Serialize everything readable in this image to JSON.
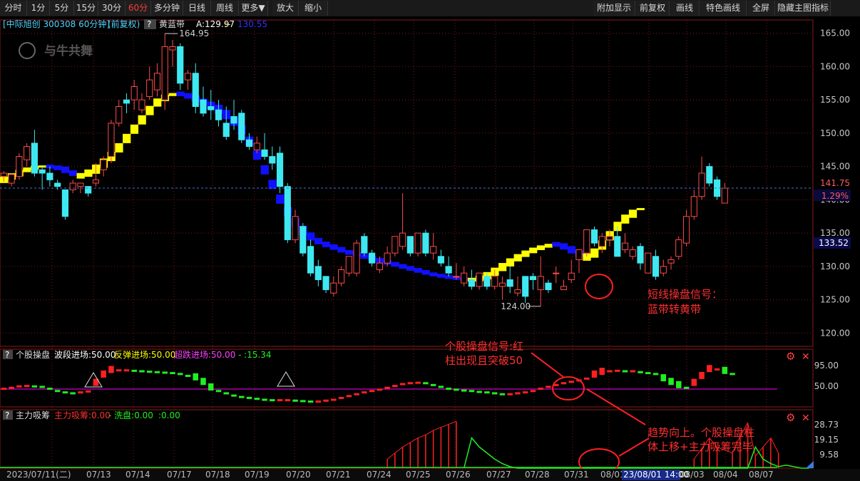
{
  "toolbar": {
    "left": [
      "分时",
      "1分",
      "5分",
      "15分",
      "30分",
      "60分",
      "多分钟",
      "日线",
      "周线",
      "更多▼",
      "放大",
      "缩小"
    ],
    "active": "60分",
    "right": [
      "附加显示",
      "前复权",
      "画线",
      "特色画线",
      "全屏",
      "隐藏主图指标"
    ]
  },
  "header": {
    "title": "[中际旭创 300308 60分钟]",
    "adj": "(前复权)",
    "help": "?",
    "indicator": "黄蓝带",
    "a_value": "A:129.97",
    "sep": ":-",
    "b_value": "130.55",
    "logo": "与牛共舞"
  },
  "colors": {
    "up": "#ff4a4a",
    "down": "#3ee8f0",
    "yellow": "#ffff00",
    "blue": "#1010ff",
    "green": "#20ee20",
    "magenta": "#ff00ff",
    "grid": "#7a1a1a",
    "axis_text": "#c8c8c8"
  },
  "annotations": {
    "high_label": "164.95",
    "low_label": "124.00",
    "current_price": "141.75",
    "change_pct": "1.29%",
    "band_price": "133.52",
    "note1": [
      "短线操盘信号：",
      "蓝带转黄带"
    ],
    "note2": [
      "个股操盘信号:红",
      "柱出现且突破50"
    ],
    "note3": [
      "趋势向上。个股操盘柱",
      "体上移+主力吸筹完毕"
    ]
  },
  "sub1": {
    "help": "?",
    "name": "个股操盘",
    "l1": "波段进场:50.00",
    "l2": "反弹进场:50.00",
    "l3": "超跌进场:50.00",
    "l4": "- :15.34",
    "yticks": [
      "95.00",
      "50.00"
    ]
  },
  "sub2": {
    "help": "?",
    "name": "主力吸筹",
    "l1": "主力吸筹:0.00",
    "l2": "- 洗盘:0.00",
    "l3": ":0.00",
    "yticks": [
      "28.73",
      "19.15",
      "9.58"
    ]
  },
  "xaxis": {
    "labels": [
      "2023/07/11(二)",
      "07/13",
      "07/14",
      "07/17",
      "07/18",
      "07/19",
      "07/20",
      "07/21",
      "07/24",
      "07/25",
      "07/26",
      "07/27",
      "07/28",
      "07/31",
      "08/01",
      "08/03",
      "08/04",
      "08/07"
    ],
    "cursor_label": "23/08/01 14:00"
  },
  "chart_data": {
    "type": "candlestick",
    "title": "[中际旭创 300308 60分钟]",
    "ylim": [
      118,
      167
    ],
    "yticks": [
      120,
      125,
      130,
      135,
      140,
      145,
      150,
      155,
      160,
      165
    ],
    "grid": true,
    "candles": [
      [
        143.5,
        144.3,
        144.0,
        142.7
      ],
      [
        142.5,
        144.0,
        143.8,
        142.0
      ],
      [
        143.5,
        147.0,
        146.5,
        143.0
      ],
      [
        146.0,
        148.5,
        148.0,
        145.0
      ],
      [
        148.5,
        150.5,
        144.0,
        143.5
      ],
      [
        144.5,
        145.0,
        144.0,
        141.5
      ],
      [
        144.0,
        145.0,
        143.0,
        142.0
      ],
      [
        142.5,
        143.0,
        142.0,
        141.5
      ],
      [
        141.5,
        141.5,
        137.5,
        137.0
      ],
      [
        141.5,
        143.0,
        142.5,
        141.0
      ],
      [
        142.0,
        142.5,
        142.5,
        141.0
      ],
      [
        142.0,
        142.0,
        141.0,
        140.5
      ],
      [
        142.5,
        145.5,
        143.0,
        142.0
      ],
      [
        144.5,
        146.5,
        146.0,
        143.5
      ],
      [
        146.5,
        152.0,
        151.5,
        145.5
      ],
      [
        151.5,
        155.0,
        154.0,
        151.0
      ],
      [
        155.0,
        156.0,
        154.5,
        153.0
      ],
      [
        155.0,
        158.0,
        157.0,
        153.5
      ],
      [
        153.5,
        156.0,
        155.0,
        153.0
      ],
      [
        155.5,
        160.0,
        158.0,
        155.0
      ],
      [
        156.5,
        160.5,
        159.0,
        155.5
      ],
      [
        155.0,
        164.95,
        163.0,
        153.5
      ],
      [
        162.5,
        164.0,
        163.0,
        160.0
      ],
      [
        163.0,
        163.5,
        157.5,
        156.5
      ],
      [
        158.0,
        159.5,
        159.0,
        156.5
      ],
      [
        159.0,
        160.5,
        154.0,
        153.0
      ],
      [
        155.0,
        157.0,
        153.0,
        152.5
      ],
      [
        154.0,
        156.5,
        153.5,
        152.0
      ],
      [
        153.5,
        155.0,
        152.0,
        151.0
      ],
      [
        151.5,
        154.0,
        149.5,
        149.0
      ],
      [
        152.5,
        155.0,
        151.5,
        150.5
      ],
      [
        153.0,
        153.5,
        149.0,
        148.5
      ],
      [
        149.0,
        150.0,
        148.0,
        147.5
      ],
      [
        147.5,
        149.5,
        148.5,
        147.0
      ],
      [
        147.5,
        150.0,
        146.5,
        146.0
      ],
      [
        146.5,
        148.0,
        145.5,
        144.5
      ],
      [
        147.0,
        148.0,
        142.0,
        141.0
      ],
      [
        142.0,
        142.5,
        134.0,
        133.5
      ],
      [
        134.0,
        138.5,
        137.5,
        133.5
      ],
      [
        136.0,
        136.5,
        132.0,
        131.5
      ],
      [
        133.0,
        134.0,
        129.0,
        128.5
      ],
      [
        130.0,
        131.0,
        128.0,
        127.0
      ],
      [
        128.5,
        128.5,
        126.5,
        126.0
      ],
      [
        126.0,
        128.5,
        127.5,
        125.5
      ],
      [
        127.5,
        130.0,
        129.5,
        127.0
      ],
      [
        129.0,
        131.5,
        131.5,
        128.5
      ],
      [
        129.0,
        134.0,
        133.5,
        128.5
      ],
      [
        134.5,
        135.0,
        132.0,
        131.5
      ],
      [
        132.0,
        132.5,
        130.5,
        130.0
      ],
      [
        129.5,
        131.5,
        130.5,
        129.0
      ],
      [
        130.5,
        133.0,
        132.0,
        130.0
      ],
      [
        132.0,
        133.5,
        134.5,
        131.5
      ],
      [
        133.0,
        141.0,
        135.0,
        132.5
      ],
      [
        134.5,
        134.5,
        132.0,
        131.5
      ],
      [
        132.0,
        134.0,
        135.0,
        131.5
      ],
      [
        135.0,
        135.5,
        132.0,
        131.5
      ],
      [
        132.0,
        135.0,
        133.0,
        131.0
      ],
      [
        131.5,
        132.5,
        130.5,
        130.0
      ],
      [
        130.0,
        131.5,
        129.0,
        128.5
      ],
      [
        128.5,
        130.5,
        128.5,
        128.0
      ],
      [
        127.5,
        130.0,
        129.0,
        127.0
      ],
      [
        128.0,
        129.5,
        127.0,
        126.5
      ],
      [
        127.0,
        129.0,
        129.0,
        126.5
      ],
      [
        128.5,
        129.0,
        127.0,
        126.5
      ],
      [
        127.0,
        129.5,
        128.5,
        126.5
      ],
      [
        127.0,
        128.5,
        127.5,
        125.0
      ],
      [
        128.0,
        130.0,
        127.0,
        126.0
      ],
      [
        126.0,
        128.5,
        126.5,
        125.5
      ],
      [
        128.5,
        128.5,
        125.5,
        124.5
      ],
      [
        128.5,
        129.0,
        128.0,
        126.5
      ],
      [
        126.5,
        131.5,
        128.5,
        124.0
      ],
      [
        127.5,
        128.0,
        126.5,
        126.0
      ],
      [
        129.0,
        130.0,
        129.0,
        127.5
      ],
      [
        126.5,
        128.0,
        127.0,
        126.5
      ],
      [
        128.0,
        131.0,
        129.0,
        127.5
      ],
      [
        131.0,
        132.5,
        132.5,
        129.0
      ],
      [
        132.0,
        135.5,
        135.5,
        131.5
      ],
      [
        135.5,
        136.0,
        133.5,
        133.0
      ],
      [
        133.0,
        135.0,
        134.5,
        132.0
      ],
      [
        134.0,
        135.5,
        134.5,
        133.0
      ],
      [
        134.5,
        136.0,
        131.5,
        131.5
      ],
      [
        132.5,
        135.0,
        133.5,
        132.0
      ],
      [
        131.5,
        133.0,
        132.5,
        131.0
      ],
      [
        133.0,
        133.5,
        130.5,
        129.5
      ],
      [
        129.0,
        132.0,
        132.0,
        129.0
      ],
      [
        131.5,
        132.5,
        128.5,
        128.0
      ],
      [
        129.0,
        131.0,
        130.0,
        128.5
      ],
      [
        130.5,
        131.5,
        131.0,
        129.5
      ],
      [
        131.5,
        134.5,
        134.0,
        131.0
      ],
      [
        133.5,
        138.5,
        137.5,
        133.0
      ],
      [
        137.5,
        141.5,
        140.5,
        137.0
      ],
      [
        140.5,
        146.5,
        144.0,
        140.0
      ],
      [
        145.0,
        145.5,
        142.5,
        142.0
      ],
      [
        143.0,
        143.5,
        140.5,
        140.0
      ],
      [
        139.5,
        142.5,
        141.75,
        139.5
      ]
    ],
    "band": [
      {
        "type": "yellow",
        "values": [
          143.0,
          143.5,
          144.0,
          144.5,
          144.8,
          145.0,
          145.0
        ]
      },
      {
        "type": "blue",
        "values": [
          145.0,
          144.8,
          144.5,
          144.0,
          143.6
        ]
      },
      {
        "type": "yellow",
        "values": [
          143.6,
          144.0,
          144.6,
          145.5,
          146.5,
          147.8,
          149.2,
          150.6,
          152.0,
          153.4,
          154.6,
          155.3,
          155.8,
          155.9
        ]
      },
      {
        "type": "blue",
        "values": [
          155.9,
          155.6,
          155.2,
          154.7,
          154.2,
          153.6,
          152.8,
          151.8,
          150.5,
          148.8,
          146.7,
          144.5,
          142.3,
          140.1,
          138.2,
          136.6,
          135.4,
          134.5,
          133.8,
          133.3,
          132.9,
          132.5,
          132.1,
          131.8,
          131.5,
          131.2,
          130.9,
          130.6,
          130.3,
          130.0,
          129.7,
          129.4,
          129.1,
          128.8,
          128.6,
          128.4,
          128.2,
          128.1,
          128.0
        ]
      },
      {
        "type": "yellow",
        "values": [
          128.0,
          128.2,
          128.6,
          129.2,
          129.9,
          130.6,
          131.3,
          131.9,
          132.4,
          132.8,
          133.1,
          133.3
        ]
      },
      {
        "type": "blue",
        "values": [
          133.3,
          133.0,
          132.5,
          131.9,
          131.4
        ]
      },
      {
        "type": "yellow",
        "values": [
          131.4,
          132.0,
          133.2,
          134.6,
          136.0,
          137.1,
          137.9,
          138.6
        ]
      }
    ],
    "oscillator": {
      "name": "个股操盘",
      "ylim": [
        15,
        105
      ],
      "line": 50,
      "values": [
        50,
        52,
        55,
        56,
        55,
        54,
        50,
        45,
        42,
        40,
        42,
        44,
        60,
        78,
        88,
        90,
        90,
        89,
        88,
        87,
        86,
        85,
        84,
        82,
        78,
        72,
        62,
        50,
        45,
        40,
        35,
        32,
        30,
        28,
        26,
        25,
        25,
        25,
        24,
        23,
        22,
        22,
        24,
        26,
        30,
        34,
        38,
        42,
        45,
        48,
        52,
        56,
        60,
        62,
        63,
        62,
        58,
        54,
        50,
        48,
        46,
        45,
        43,
        42,
        40,
        38,
        38,
        40,
        42,
        45,
        50,
        54,
        58,
        62,
        65,
        68,
        72,
        78,
        84,
        88,
        89,
        88,
        88,
        86,
        84,
        82,
        70,
        62,
        55,
        52,
        60,
        75,
        90,
        92,
        86,
        82
      ]
    },
    "accumulation": {
      "name": "主力吸筹",
      "ylim": [
        0,
        32
      ],
      "red_bars": [
        [
          50,
          6
        ],
        [
          51,
          10
        ],
        [
          52,
          14
        ],
        [
          53,
          17
        ],
        [
          54,
          20
        ],
        [
          55,
          22
        ],
        [
          56,
          25
        ],
        [
          57,
          27
        ],
        [
          58,
          29
        ],
        [
          59,
          31
        ],
        [
          90,
          6
        ],
        [
          91,
          13
        ],
        [
          92,
          20
        ],
        [
          93,
          14
        ],
        [
          95,
          10
        ],
        [
          96,
          21
        ],
        [
          97,
          30
        ],
        [
          98,
          8
        ],
        [
          99,
          14
        ],
        [
          100,
          20
        ],
        [
          101,
          10
        ]
      ],
      "green_line": [
        [
          60,
          0
        ],
        [
          61,
          20
        ],
        [
          62,
          14
        ],
        [
          63,
          10
        ],
        [
          64,
          6
        ],
        [
          65,
          3
        ],
        [
          66,
          1
        ],
        [
          67,
          0
        ],
        [
          97,
          0
        ],
        [
          98,
          14
        ],
        [
          99,
          6
        ],
        [
          100,
          3
        ],
        [
          101,
          1
        ],
        [
          102,
          2
        ],
        [
          103,
          1
        ],
        [
          104,
          0
        ],
        [
          105,
          0
        ]
      ]
    }
  }
}
